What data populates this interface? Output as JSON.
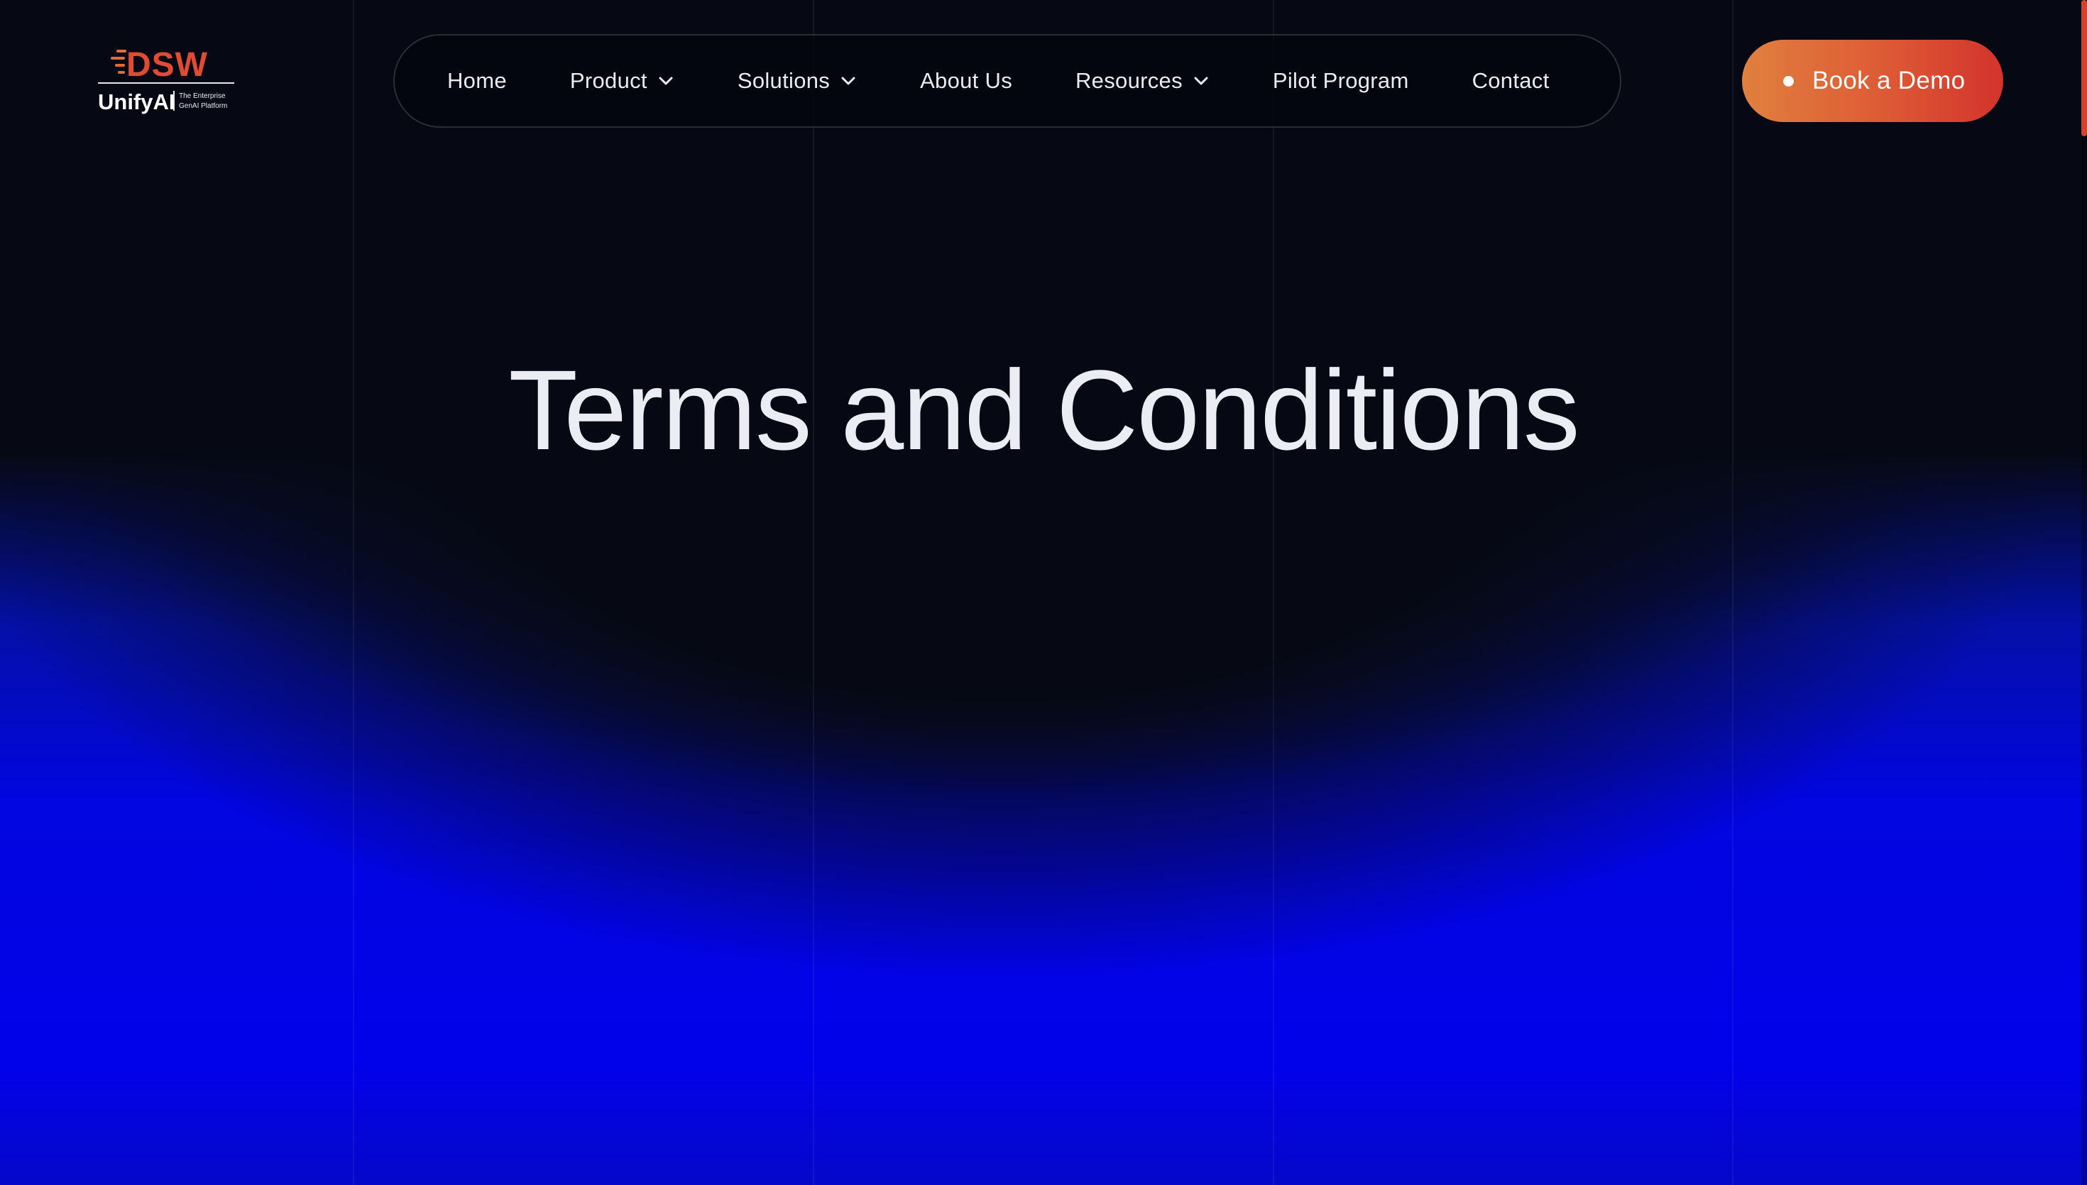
{
  "logo": {
    "brand": "DSW",
    "product": "UnifyAI",
    "tagline_line1": "The Enterprise",
    "tagline_line2": "GenAI Platform"
  },
  "nav": {
    "items": [
      {
        "label": "Home"
      },
      {
        "label": "Product"
      },
      {
        "label": "Solutions"
      },
      {
        "label": "About Us"
      },
      {
        "label": "Resources"
      },
      {
        "label": "Pilot Program"
      },
      {
        "label": "Contact"
      }
    ]
  },
  "cta": {
    "label": "Book a Demo"
  },
  "hero": {
    "title": "Terms and Conditions"
  },
  "colors": {
    "background": "#060914",
    "glow_blue": "#0202ea",
    "accent_orange": "#e0803e",
    "accent_red": "#d3332c",
    "text": "#ecedf2"
  },
  "icons": {
    "dropdown": "chevron-down-icon",
    "cta_bullet": "dot-icon"
  }
}
